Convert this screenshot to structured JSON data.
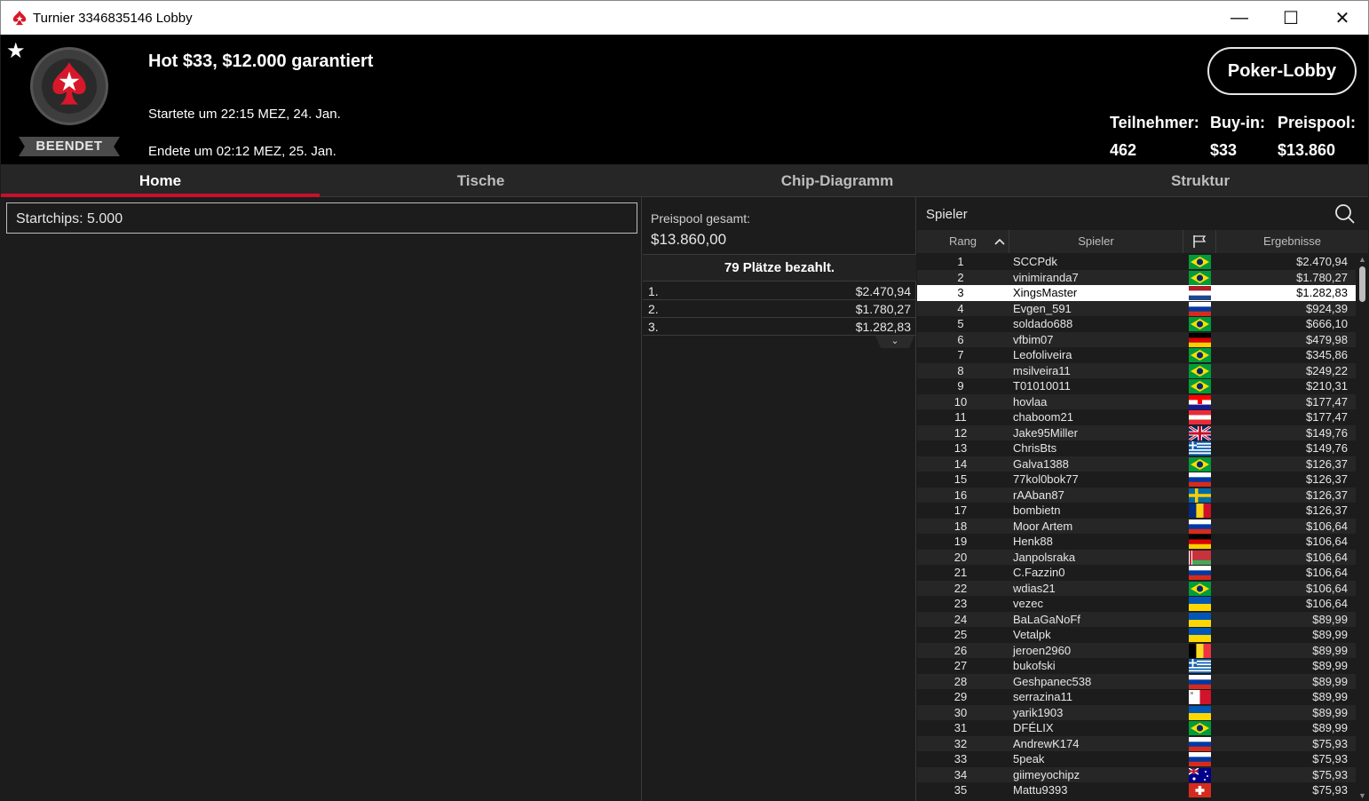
{
  "window": {
    "title": "Turnier 3346835146 Lobby",
    "minimize": "—",
    "maximize": "☐",
    "close": "✕"
  },
  "header": {
    "favorite_icon": "star-icon",
    "status": "BEENDET",
    "tournament_name": "Hot $33, $12.000 garantiert",
    "started": "Startete um 22:15 MEZ, 24. Jan.",
    "ended": "Endete um 02:12 MEZ, 25. Jan.",
    "lobby_button": "Poker-Lobby",
    "stats": {
      "entrants_label": "Teilnehmer:",
      "entrants_value": "462",
      "buyin_label": "Buy-in:",
      "buyin_value": "$33",
      "prizepool_label": "Preispool:",
      "prizepool_value": "$13.860"
    }
  },
  "tabs": [
    "Home",
    "Tische",
    "Chip-Diagramm",
    "Struktur"
  ],
  "home": {
    "startchips_label": "Startchips:",
    "startchips_value": "5.000"
  },
  "prize": {
    "total_label": "Preispool gesamt:",
    "total_value": "$13.860,00",
    "places_paid": "79 Plätze bezahlt.",
    "payouts": [
      {
        "pos": "1.",
        "amount": "$2.470,94"
      },
      {
        "pos": "2.",
        "amount": "$1.780,27"
      },
      {
        "pos": "3.",
        "amount": "$1.282,83"
      }
    ]
  },
  "players": {
    "search_label": "Spieler",
    "columns": {
      "rank": "Rang",
      "player": "Spieler",
      "result": "Ergebnisse"
    },
    "highlighted_rank": "3",
    "rows": [
      {
        "rank": "1",
        "name": "SCCPdk",
        "flag": "br",
        "result": "$2.470,94"
      },
      {
        "rank": "2",
        "name": "vinimiranda7",
        "flag": "br",
        "result": "$1.780,27"
      },
      {
        "rank": "3",
        "name": "XingsMaster",
        "flag": "nl",
        "result": "$1.282,83"
      },
      {
        "rank": "4",
        "name": "Evgen_591",
        "flag": "ru",
        "result": "$924,39"
      },
      {
        "rank": "5",
        "name": "soldado688",
        "flag": "br",
        "result": "$666,10"
      },
      {
        "rank": "6",
        "name": "vfbim07",
        "flag": "de",
        "result": "$479,98"
      },
      {
        "rank": "7",
        "name": "Leofoliveira",
        "flag": "br",
        "result": "$345,86"
      },
      {
        "rank": "8",
        "name": "msilveira11",
        "flag": "br",
        "result": "$249,22"
      },
      {
        "rank": "9",
        "name": "T01010011",
        "flag": "br",
        "result": "$210,31"
      },
      {
        "rank": "10",
        "name": "hovlaa",
        "flag": "hr",
        "result": "$177,47"
      },
      {
        "rank": "11",
        "name": "chaboom21",
        "flag": "at",
        "result": "$177,47"
      },
      {
        "rank": "12",
        "name": "Jake95Miller",
        "flag": "gb",
        "result": "$149,76"
      },
      {
        "rank": "13",
        "name": "ChrisBts",
        "flag": "gr",
        "result": "$149,76"
      },
      {
        "rank": "14",
        "name": "Galva1388",
        "flag": "br",
        "result": "$126,37"
      },
      {
        "rank": "15",
        "name": "77kol0bok77",
        "flag": "ru",
        "result": "$126,37"
      },
      {
        "rank": "16",
        "name": "rAAban87",
        "flag": "se",
        "result": "$126,37"
      },
      {
        "rank": "17",
        "name": "bombietn",
        "flag": "ro",
        "result": "$126,37"
      },
      {
        "rank": "18",
        "name": "Moor Artem",
        "flag": "ru",
        "result": "$106,64"
      },
      {
        "rank": "19",
        "name": "Henk88",
        "flag": "de",
        "result": "$106,64"
      },
      {
        "rank": "20",
        "name": "Janpolsraka",
        "flag": "by",
        "result": "$106,64"
      },
      {
        "rank": "21",
        "name": "C.Fazzin0",
        "flag": "ru",
        "result": "$106,64"
      },
      {
        "rank": "22",
        "name": "wdias21",
        "flag": "br",
        "result": "$106,64"
      },
      {
        "rank": "23",
        "name": "vezec",
        "flag": "ua",
        "result": "$106,64"
      },
      {
        "rank": "24",
        "name": "BaLaGaNoFf",
        "flag": "ua",
        "result": "$89,99"
      },
      {
        "rank": "25",
        "name": "Vetalpk",
        "flag": "ua",
        "result": "$89,99"
      },
      {
        "rank": "26",
        "name": "jeroen2960",
        "flag": "be",
        "result": "$89,99"
      },
      {
        "rank": "27",
        "name": "bukofski",
        "flag": "gr",
        "result": "$89,99"
      },
      {
        "rank": "28",
        "name": "Geshpanec538",
        "flag": "ru",
        "result": "$89,99"
      },
      {
        "rank": "29",
        "name": "serrazina11",
        "flag": "mt",
        "result": "$89,99"
      },
      {
        "rank": "30",
        "name": "yarik1903",
        "flag": "ua",
        "result": "$89,99"
      },
      {
        "rank": "31",
        "name": "DFÉLIX",
        "flag": "br",
        "result": "$89,99"
      },
      {
        "rank": "32",
        "name": "AndrewK174",
        "flag": "ru",
        "result": "$75,93"
      },
      {
        "rank": "33",
        "name": "5peak",
        "flag": "ru",
        "result": "$75,93"
      },
      {
        "rank": "34",
        "name": "giimeyochipz",
        "flag": "au",
        "result": "$75,93"
      },
      {
        "rank": "35",
        "name": "Mattu9393",
        "flag": "ch",
        "result": "$75,93"
      }
    ]
  },
  "colors": {
    "accent": "#c8102e",
    "background": "#1c1c1c",
    "header_bg": "#000000"
  }
}
